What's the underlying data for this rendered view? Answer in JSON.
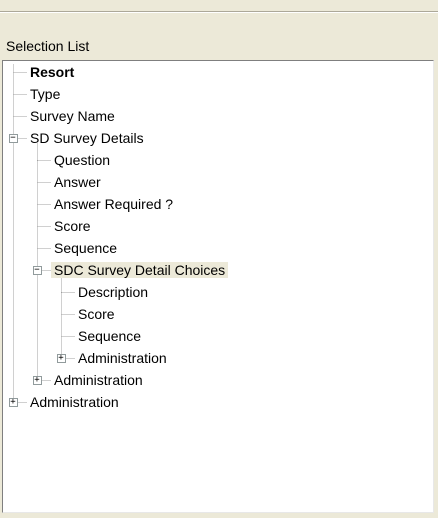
{
  "panel": {
    "title": "Selection List"
  },
  "tree": {
    "nodes": [
      {
        "label": "Resort",
        "level": 0,
        "bold": true
      },
      {
        "label": "Type",
        "level": 0
      },
      {
        "label": "Survey Name",
        "level": 0
      },
      {
        "label": "SD  Survey Details",
        "level": 0,
        "toggle": "-"
      },
      {
        "label": "Question",
        "level": 1
      },
      {
        "label": "Answer",
        "level": 1
      },
      {
        "label": "Answer Required ?",
        "level": 1
      },
      {
        "label": "Score",
        "level": 1
      },
      {
        "label": "Sequence",
        "level": 1
      },
      {
        "label": "SDC  Survey Detail Choices",
        "level": 1,
        "toggle": "-",
        "selected": true
      },
      {
        "label": "Description",
        "level": 2
      },
      {
        "label": "Score",
        "level": 2
      },
      {
        "label": "Sequence",
        "level": 2
      },
      {
        "label": "Administration",
        "level": 2,
        "toggle": "+"
      },
      {
        "label": "Administration",
        "level": 1,
        "toggle": "+"
      },
      {
        "label": "Administration",
        "level": 0,
        "toggle": "+"
      }
    ],
    "toggle_expanded_glyph": "−",
    "toggle_collapsed_glyph": "+"
  },
  "colors": {
    "selected_bg": "#ece9d8",
    "dotted_line": "#a0a0a0"
  }
}
